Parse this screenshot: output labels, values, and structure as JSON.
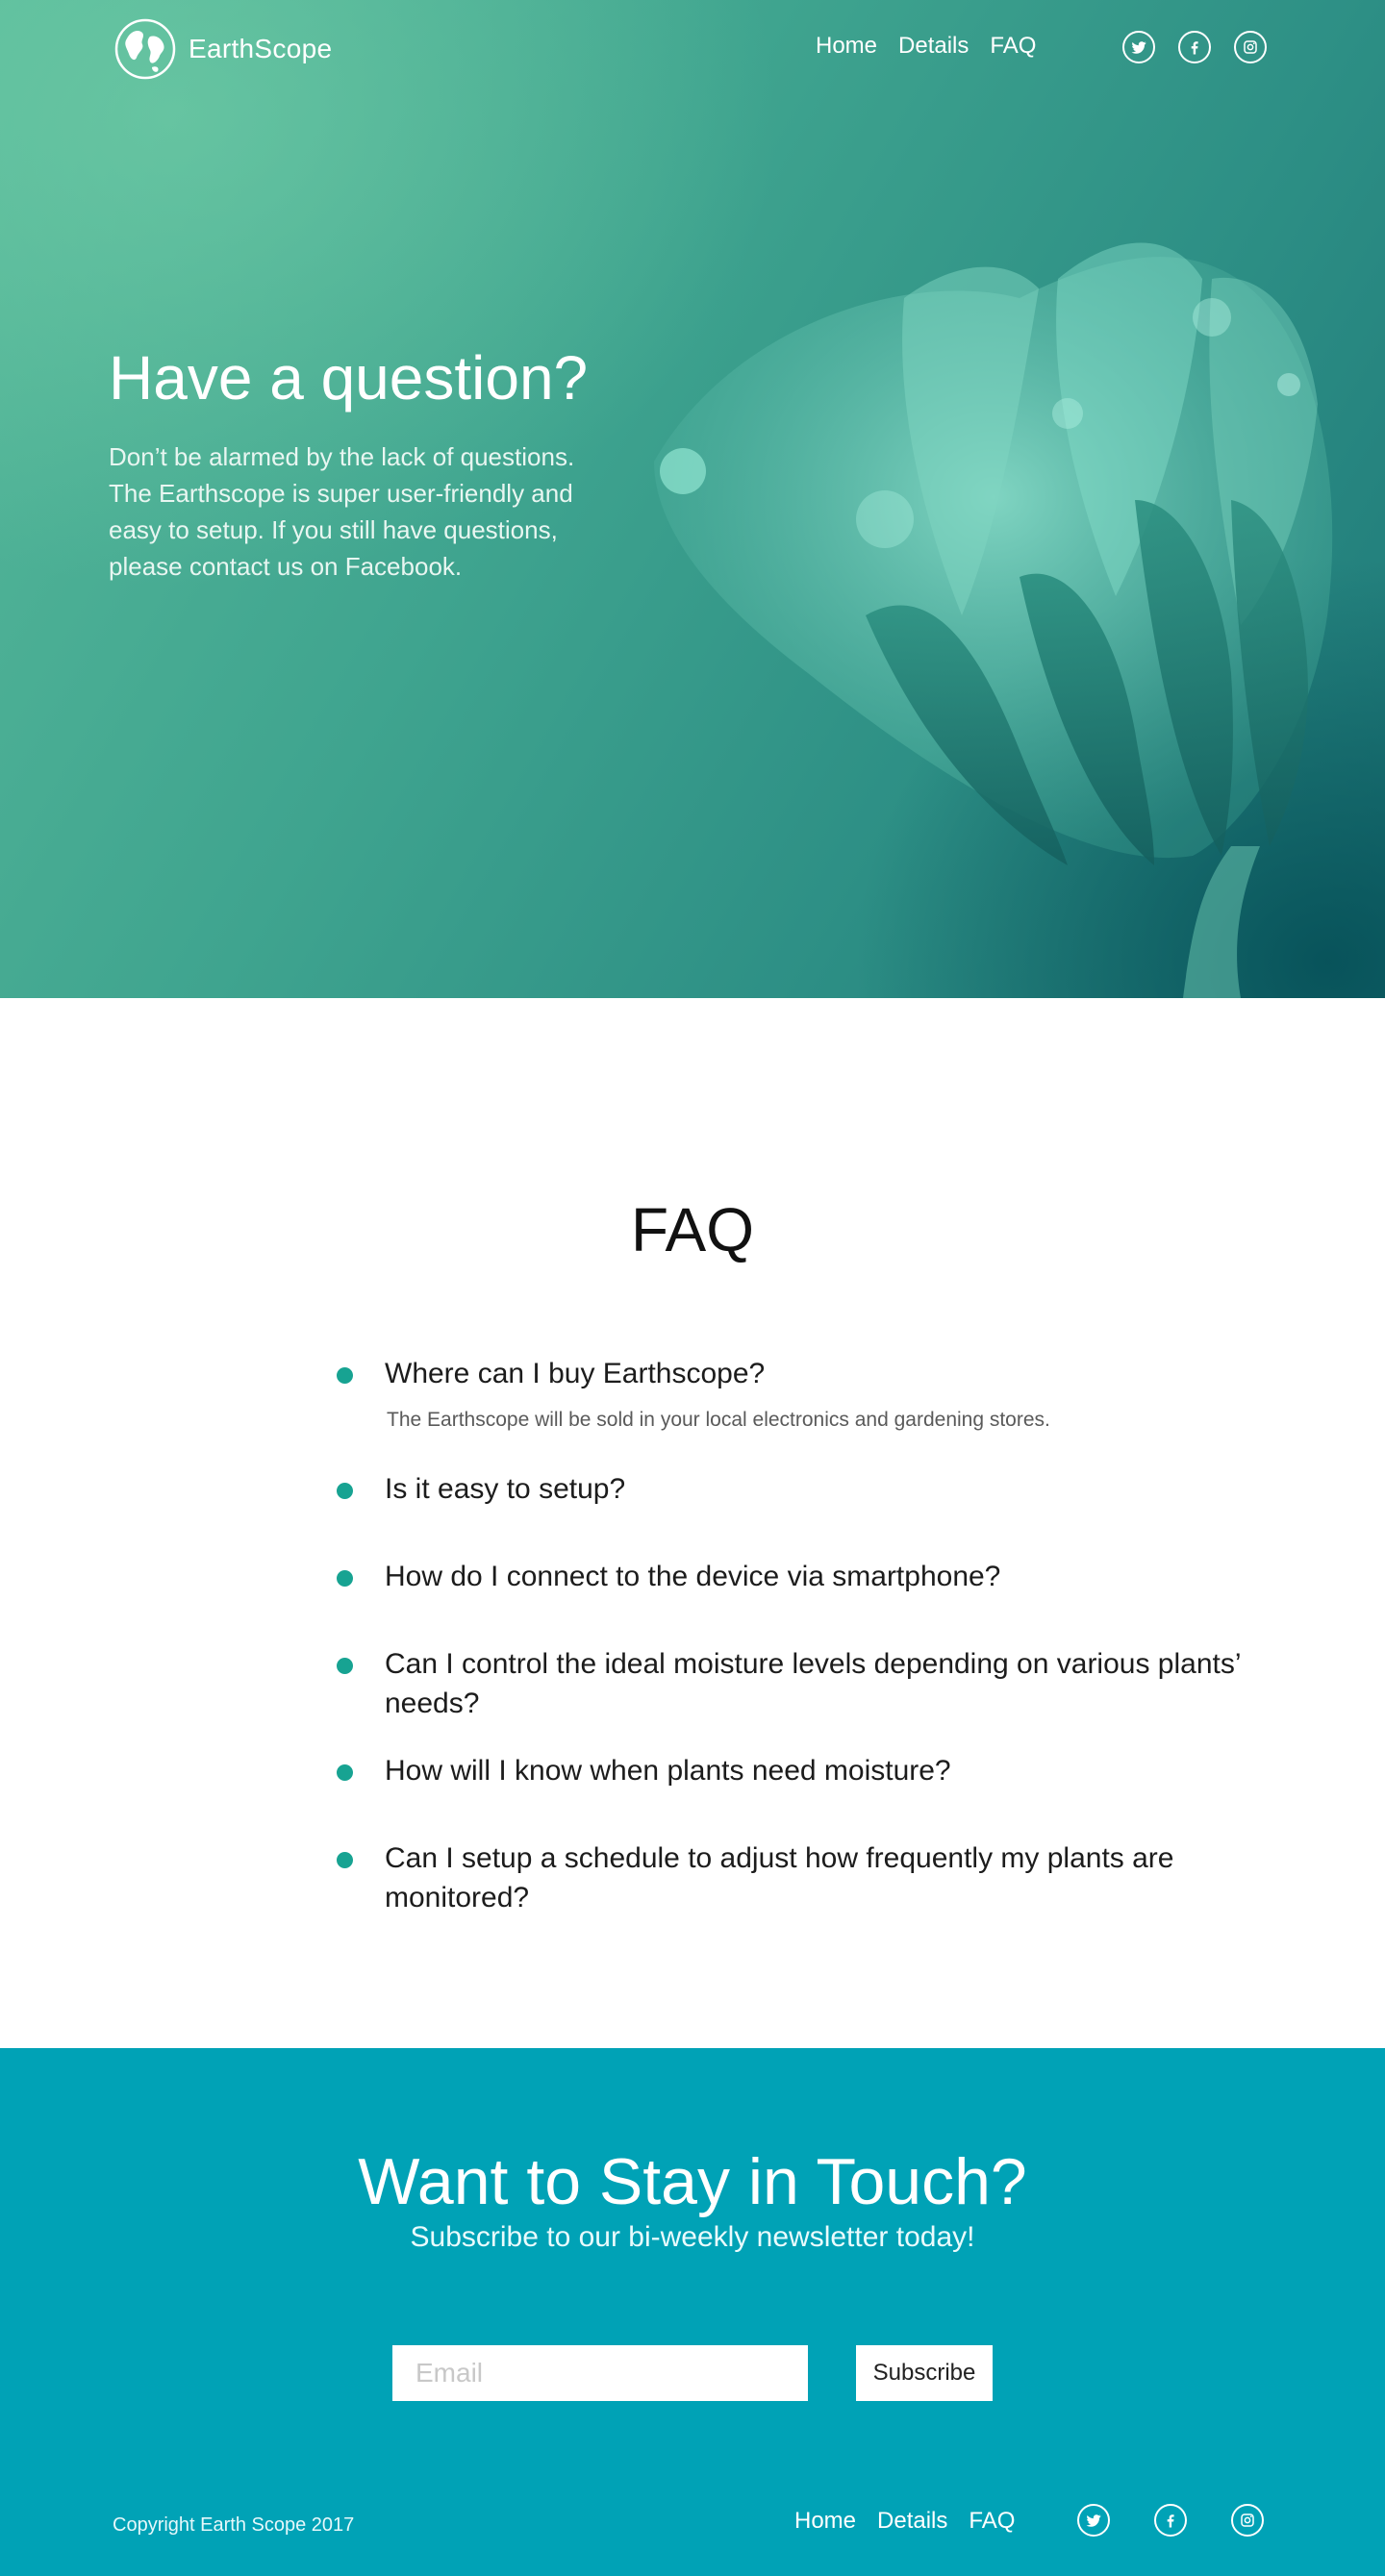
{
  "header": {
    "brand_name": "EarthScope",
    "nav": [
      "Home",
      "Details",
      "FAQ"
    ],
    "social_icons": [
      "twitter-icon",
      "facebook-icon",
      "instagram-icon"
    ]
  },
  "hero": {
    "title": "Have a question?",
    "text": "Don’t be alarmed by the lack of questions. The Earthscope is super user-friendly and easy to setup. If you still have questions, please contact us on Facebook."
  },
  "faq": {
    "title": "FAQ",
    "items": [
      {
        "question": "Where can I buy Earthscope?",
        "answer": "The Earthscope will be sold in your local electronics and gardening stores."
      },
      {
        "question": "Is it easy to setup?"
      },
      {
        "question": "How do I connect to the device via smartphone?"
      },
      {
        "question": "Can I control the ideal moisture levels depending on various plants’ needs?"
      },
      {
        "question": "How will I know when plants need moisture?"
      },
      {
        "question": "Can I setup a schedule to adjust how frequently my plants are monitored?"
      }
    ]
  },
  "newsletter": {
    "title": "Want to Stay in Touch?",
    "subtitle": "Subscribe to our bi-weekly newsletter today!",
    "email_placeholder": "Email",
    "subscribe_label": "Subscribe"
  },
  "footer": {
    "copyright": "Copyright Earth Scope 2017",
    "nav": [
      "Home",
      "Details",
      "FAQ"
    ]
  },
  "colors": {
    "hero_teal": "#3fa48f",
    "accent_dot": "#17a392",
    "newsletter_bg": "#00a2b6"
  }
}
